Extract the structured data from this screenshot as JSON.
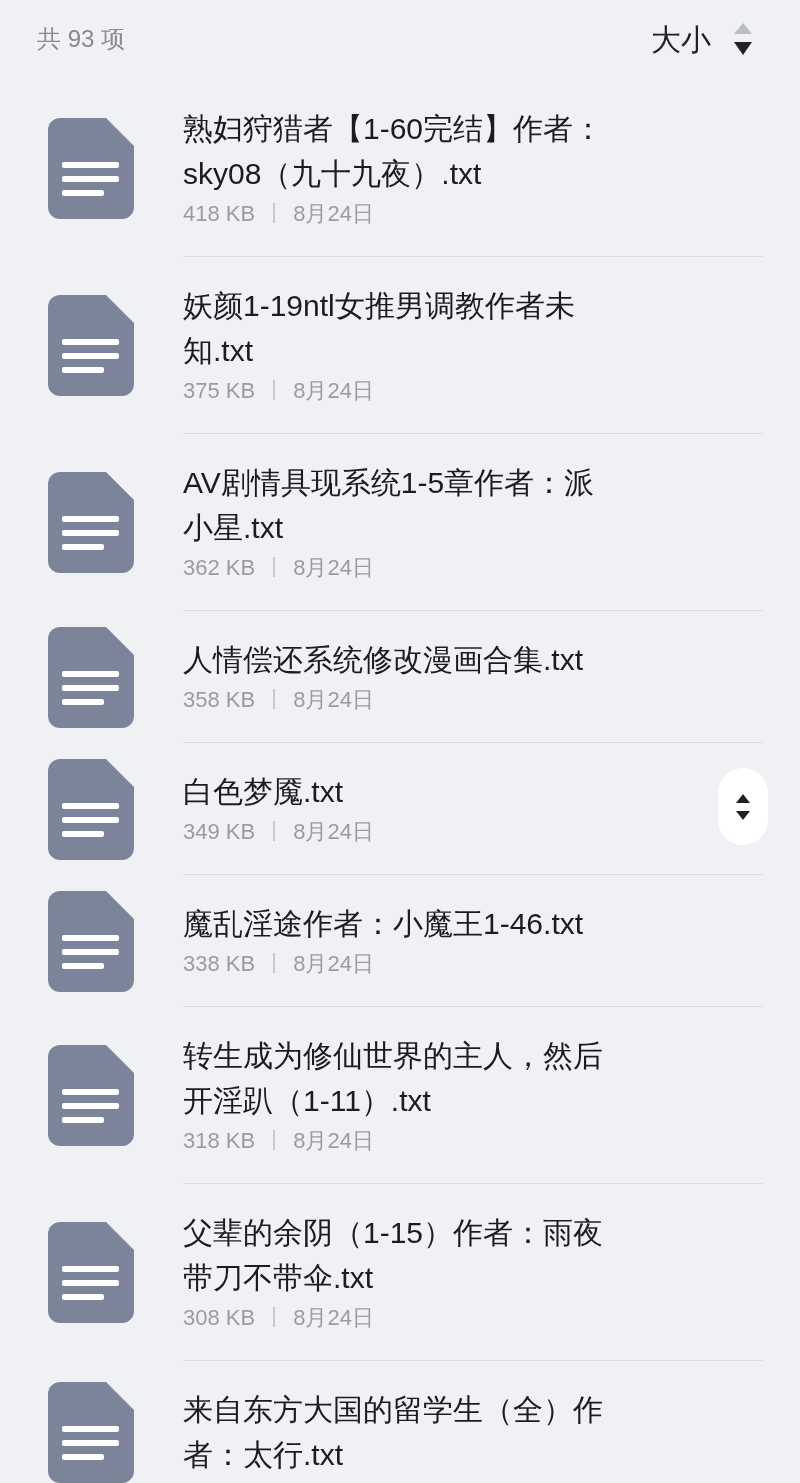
{
  "header": {
    "count": "共 93 项",
    "sort_label": "大小",
    "sort_descending": true
  },
  "files": [
    {
      "name_lines": [
        "熟妇狩猎者【1-60完结】作者：",
        "sky08（九十九夜）.txt"
      ],
      "size": "418 KB",
      "date": "8月24日"
    },
    {
      "name_lines": [
        "妖颜1-19ntl女推男调教作者未",
        "知.txt"
      ],
      "size": "375 KB",
      "date": "8月24日"
    },
    {
      "name_lines": [
        "AV剧情具现系统1-5章作者：派",
        "小星.txt"
      ],
      "size": "362 KB",
      "date": "8月24日"
    },
    {
      "name_lines": [
        "人情偿还系统修改漫画合集.txt"
      ],
      "size": "358 KB",
      "date": "8月24日"
    },
    {
      "name_lines": [
        "白色梦魇.txt"
      ],
      "size": "349 KB",
      "date": "8月24日"
    },
    {
      "name_lines": [
        "魔乱淫途作者：小魔王1-46.txt"
      ],
      "size": "338 KB",
      "date": "8月24日"
    },
    {
      "name_lines": [
        "转生成为修仙世界的主人，然后",
        "开淫趴（1-11）.txt"
      ],
      "size": "318 KB",
      "date": "8月24日"
    },
    {
      "name_lines": [
        "父辈的余阴（1-15）作者：雨夜",
        "带刀不带伞.txt"
      ],
      "size": "308 KB",
      "date": "8月24日"
    },
    {
      "name_lines": [
        "来自东方大国的留学生（全）作",
        "者：太行.txt"
      ]
    }
  ]
}
